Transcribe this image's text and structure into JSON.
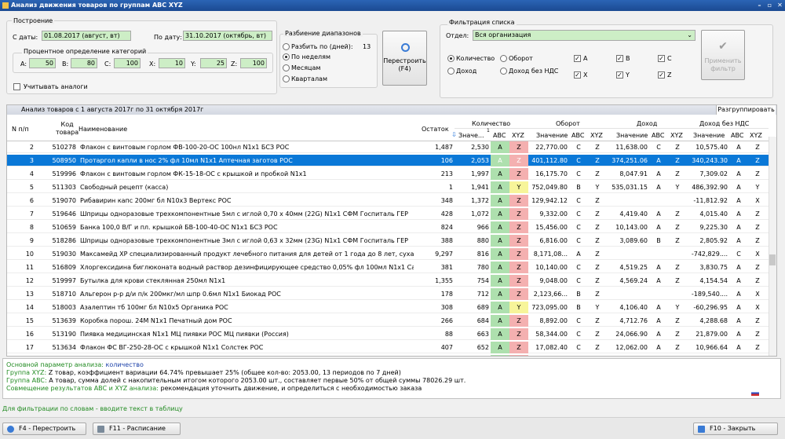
{
  "window": {
    "title": "Анализ движения товаров по группам ABC XYZ"
  },
  "build": {
    "title": "Построение",
    "from_label": "С даты:",
    "from_value": "01.08.2017  (август, вт)",
    "to_label": "По дату:",
    "to_value": "31.10.2017  (октябрь, вт)",
    "pct_title": "Процентное определение категорий",
    "A_label": "A:",
    "A_value": "50",
    "B_label": "B:",
    "B_value": "80",
    "C_label": "C:",
    "C_value": "100",
    "X_label": "X:",
    "X_value": "10",
    "Y_label": "Y:",
    "Y_value": "25",
    "Z_label": "Z:",
    "Z_value": "100",
    "analogs_label": "Учитывать аналоги"
  },
  "ranges": {
    "title": "Разбиение диапазонов",
    "by_days": "Разбить по (дней):",
    "days_value": "13",
    "by_weeks": "По неделям",
    "by_months": "Месяцам",
    "by_quarters": "Кварталам"
  },
  "rebuild_button": "Перестроить\n(F4)",
  "filter": {
    "title": "Фильтрация списка",
    "dept_label": "Отдел:",
    "dept_value": "Вся организация",
    "qty": "Количество",
    "turnover": "Оборот",
    "income": "Доход",
    "income_novat": "Доход без НДС",
    "cA": "A",
    "cB": "B",
    "cC": "C",
    "cX": "X",
    "cY": "Y",
    "cZ": "Z",
    "apply_button": "Применить\nфильтр"
  },
  "grid": {
    "header_title": "Анализ товаров с 1 августа 2017г по 31 октября 2017г",
    "regroup_button": "Разгруппировать",
    "headers": {
      "n": "N п/п",
      "code": "Код\nтовара",
      "name": "Наименование",
      "rest": "Остаток",
      "qty": "Количество",
      "turnover": "Оборот",
      "income": "Доход",
      "income_novat": "Доход без НДС",
      "value": "Значение",
      "value_sorted": "Значе...",
      "sort_index": "1",
      "abc": "ABC",
      "xyz": "XYZ"
    },
    "rows": [
      {
        "n": "2",
        "code": "510278",
        "name": "Флакон с винтовым горлом ФВ-100-20-ОС 100нл N1х1 БСЗ РОС",
        "rest": "1,487",
        "qty": "2,530",
        "qa": "A",
        "qx": "Z",
        "turn": "22,770.00",
        "ta": "C",
        "tx": "Z",
        "inc": "11,638.00",
        "ia": "C",
        "ix": "Z",
        "inv": "10,575.40",
        "va": "A",
        "vx": "Z"
      },
      {
        "n": "3",
        "code": "508950",
        "name": "Протаргол капли в нос 2% фл 10мл N1х1 Аптечная заготов РОС",
        "rest": "106",
        "qty": "2,053",
        "qa": "A",
        "qx": "Z",
        "turn": "401,112.80",
        "ta": "C",
        "tx": "Z",
        "inc": "374,251.06",
        "ia": "A",
        "ix": "Z",
        "inv": "340,243.30",
        "va": "A",
        "vx": "Z",
        "sel": true
      },
      {
        "n": "4",
        "code": "519996",
        "name": "Флакон с винтовым горлом ФК-15-18-ОС с крышкой и пробкой N1х1",
        "rest": "213",
        "qty": "1,997",
        "qa": "A",
        "qx": "Z",
        "turn": "16,175.70",
        "ta": "C",
        "tx": "Z",
        "inc": "8,047.91",
        "ia": "A",
        "ix": "Z",
        "inv": "7,309.02",
        "va": "A",
        "vx": "Z"
      },
      {
        "n": "5",
        "code": "511303",
        "name": "Свободный рецепт (касса)",
        "rest": "1",
        "qty": "1,941",
        "qa": "A",
        "qx": "Y",
        "turn": "752,049.80",
        "ta": "B",
        "tx": "Y",
        "inc": "535,031.15",
        "ia": "A",
        "ix": "Y",
        "inv": "486,392.90",
        "va": "A",
        "vx": "Y"
      },
      {
        "n": "6",
        "code": "519070",
        "name": "Рибавирин капс 200мг бл N10х3 Вертекс РОС",
        "rest": "348",
        "qty": "1,372",
        "qa": "A",
        "qx": "Z",
        "turn": "129,942.12",
        "ta": "C",
        "tx": "Z",
        "inc": "",
        "ia": "",
        "ix": "",
        "inv": "-11,812.92",
        "va": "A",
        "vx": "X"
      },
      {
        "n": "7",
        "code": "519646",
        "name": "Шприцы одноразовые трехкомпонентные 5мл с иглой 0,70 x 40мм (22G) N1х1 СФМ Госпиталь ГЕР",
        "rest": "428",
        "qty": "1,072",
        "qa": "A",
        "qx": "Z",
        "turn": "9,332.00",
        "ta": "C",
        "tx": "Z",
        "inc": "4,419.40",
        "ia": "A",
        "ix": "Z",
        "inv": "4,015.40",
        "va": "A",
        "vx": "Z"
      },
      {
        "n": "8",
        "code": "510659",
        "name": "Банка 100,0 В/Г и пл. крышкой БВ-100-40-ОС N1х1 БСЗ РОС",
        "rest": "824",
        "qty": "966",
        "qa": "A",
        "qx": "Z",
        "turn": "15,456.00",
        "ta": "C",
        "tx": "Z",
        "inc": "10,143.00",
        "ia": "A",
        "ix": "Z",
        "inv": "9,225.30",
        "va": "A",
        "vx": "Z"
      },
      {
        "n": "9",
        "code": "518286",
        "name": "Шприцы одноразовые трехкомпонентные 3мл с иглой 0,63 x 32мм (23G) N1х1 СФМ Госпиталь ГЕР",
        "rest": "388",
        "qty": "880",
        "qa": "A",
        "qx": "Z",
        "turn": "6,816.00",
        "ta": "C",
        "tx": "Z",
        "inc": "3,089.60",
        "ia": "B",
        "ix": "Z",
        "inv": "2,805.92",
        "va": "A",
        "vx": "Z"
      },
      {
        "n": "10",
        "code": "519030",
        "name": "Максамейд ХР специализированный продукт лечебного питания для детей от 1 года до 8 лет, сухая ...",
        "rest": "9,297",
        "qty": "816",
        "qa": "A",
        "qx": "Z",
        "turn": "8,171,08...",
        "ta": "A",
        "tx": "Z",
        "inc": "",
        "ia": "",
        "ix": "",
        "inv": "-742,829....",
        "va": "C",
        "vx": "X"
      },
      {
        "n": "11",
        "code": "516809",
        "name": "Хлоргексидина биглюконата водный раствор дезинфицирующее средство 0,05% фл 100мл N1х1 Са...",
        "rest": "381",
        "qty": "780",
        "qa": "A",
        "qx": "Z",
        "turn": "10,140.00",
        "ta": "C",
        "tx": "Z",
        "inc": "4,519.25",
        "ia": "A",
        "ix": "Z",
        "inv": "3,830.75",
        "va": "A",
        "vx": "Z"
      },
      {
        "n": "12",
        "code": "519997",
        "name": "Бутылка для крови стеклянная 250мл N1х1",
        "rest": "1,355",
        "qty": "754",
        "qa": "A",
        "qx": "Z",
        "turn": "9,048.00",
        "ta": "C",
        "tx": "Z",
        "inc": "4,569.24",
        "ia": "A",
        "ix": "Z",
        "inv": "4,154.54",
        "va": "A",
        "vx": "Z"
      },
      {
        "n": "13",
        "code": "518710",
        "name": "Альгерон р-р д/и п/к 200мкг/мл шпр 0.6мл N1х1 Биокад РОС",
        "rest": "178",
        "qty": "712",
        "qa": "A",
        "qx": "Z",
        "turn": "2,123,66...",
        "ta": "B",
        "tx": "Z",
        "inc": "",
        "ia": "",
        "ix": "",
        "inv": "-189,540....",
        "va": "A",
        "vx": "X"
      },
      {
        "n": "14",
        "code": "518003",
        "name": "Азалептин тб 100мг бл N10х5 Органика РОС",
        "rest": "308",
        "qty": "689",
        "qa": "A",
        "qx": "Y",
        "turn": "723,095.00",
        "ta": "B",
        "tx": "Y",
        "inc": "4,106.40",
        "ia": "A",
        "ix": "Y",
        "inv": "-60,296.95",
        "va": "A",
        "vx": "X"
      },
      {
        "n": "15",
        "code": "513639",
        "name": "Коробка порош. 24M  N1х1 Печатный дом РОС",
        "rest": "266",
        "qty": "684",
        "qa": "A",
        "qx": "Z",
        "turn": "8,892.00",
        "ta": "C",
        "tx": "Z",
        "inc": "4,712.76",
        "ia": "A",
        "ix": "Z",
        "inv": "4,288.68",
        "va": "A",
        "vx": "Z"
      },
      {
        "n": "16",
        "code": "513190",
        "name": "Пиявка медицинская N1х1 МЦ пиявки РОС МЦ пиявки (Россия)",
        "rest": "88",
        "qty": "663",
        "qa": "A",
        "qx": "Z",
        "turn": "58,344.00",
        "ta": "C",
        "tx": "Z",
        "inc": "24,066.90",
        "ia": "A",
        "ix": "Z",
        "inv": "21,879.00",
        "va": "A",
        "vx": "Z"
      },
      {
        "n": "17",
        "code": "513634",
        "name": "Флакон ФС ВГ-250-28-ОС с крышкой N1х1 Солстек РОС",
        "rest": "407",
        "qty": "652",
        "qa": "A",
        "qx": "Z",
        "turn": "17,082.40",
        "ta": "C",
        "tx": "Z",
        "inc": "12,062.00",
        "ia": "A",
        "ix": "Z",
        "inv": "10,966.64",
        "va": "A",
        "vx": "Z"
      },
      {
        "n": "18",
        "code": "519576",
        "name": "Цитрамон П тб бл N10х1 Фармстандарт-Лексредства РОС",
        "rest": "239",
        "qty": "625",
        "qa": "A",
        "qx": "Z",
        "turn": "2,125.00",
        "ta": "C",
        "tx": "Z",
        "inc": "2,000.10",
        "ia": "B",
        "ix": "Z",
        "inv": "1,816.48",
        "va": "A",
        "vx": "Z"
      },
      {
        "n": "19",
        "code": "514144",
        "name": "Шприц BD одноразовый трехкомпонентный 2мл. с иглой 23G 1\"1/4 (0,6 х 30мм) N1х1 Б Бектон Дикин...",
        "rest": "",
        "qty": "598",
        "qa": "A",
        "qx": "Z",
        "turn": "4,464.00",
        "ta": "C",
        "tx": "Z",
        "inc": "2,247.94",
        "ia": "B",
        "ix": "Z",
        "inv": "2,042.06",
        "va": "A",
        "vx": "Z"
      }
    ]
  },
  "info": {
    "l1a": "Основной параметр анализа: ",
    "l1b": "количество",
    "l2a": "Группа XYZ: ",
    "l2b": "Z товар, коэффициент вариации 64.74% превышает 25% (общее кол-во: 2053.00, 13 периодов по 7 дней)",
    "l3a": "Группа ABC: ",
    "l3b": "А товар, сумма долей с накопительным итогом которого 2053.00 шт., составляет первые 50% от общей суммы 78026.29 шт.",
    "l4a": "Совмещение результатов ABC и XYZ анализа: ",
    "l4b": "рекомендация уточнить движение, и определиться с необходимостью заказа"
  },
  "hint": "Для фильтрации по словам - вводите текст в таблицу",
  "bottom": {
    "rebuild": "F4 - Перестроить",
    "schedule": "F11 - Расписание",
    "close": "F10 - Закрыть"
  },
  "colors": {
    "selected_row": "#0a78d7",
    "cat_A_X": "#aee0ae",
    "cat_Y": "#f7f59a",
    "cat_Z": "#f4b0b0",
    "input_bg": "#cdeec6"
  }
}
